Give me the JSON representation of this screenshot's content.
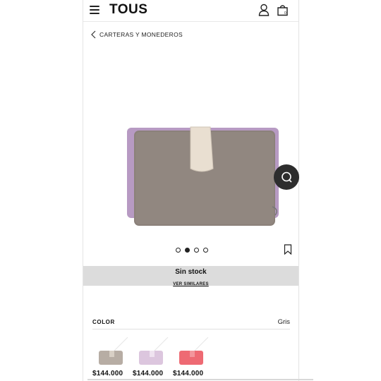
{
  "header": {
    "logo": "TOUS"
  },
  "breadcrumb": {
    "label": "CARTERAS Y MONEDEROS"
  },
  "gallery": {
    "dots": 4,
    "active_index": 1
  },
  "stock": {
    "title": "Sin stock",
    "link": "VER SIMILARES"
  },
  "color": {
    "label": "COLOR",
    "selected": "Gris"
  },
  "variants": [
    {
      "price": "$144.000",
      "color": "#b7ada4"
    },
    {
      "price": "$144.000",
      "color": "#dcc6de"
    },
    {
      "price": "$144.000",
      "color": "#ee6a73"
    }
  ],
  "product_colors": {
    "body": "#8b817a",
    "side": "#b79ac3",
    "strap": "#e9dfd1"
  }
}
